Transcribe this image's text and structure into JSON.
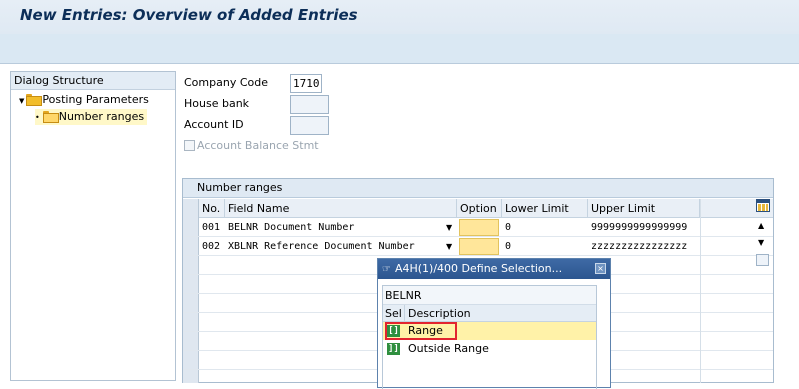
{
  "page": {
    "title": "New Entries: Overview of Added Entries"
  },
  "dialog_structure": {
    "heading": "Dialog Structure",
    "items": [
      {
        "label": "Posting Parameters",
        "level": 0,
        "expanded": true
      },
      {
        "label": "Number ranges",
        "level": 1,
        "selected": true
      }
    ]
  },
  "form": {
    "company_code_label": "Company Code",
    "company_code_value": "1710",
    "house_bank_label": "House bank",
    "house_bank_value": "",
    "account_id_label": "Account ID",
    "account_id_value": "",
    "account_balance_label": "Account Balance Stmt"
  },
  "table": {
    "title": "Number ranges",
    "columns": [
      "No.",
      "Field Name",
      "Option",
      "Lower Limit",
      "Upper Limit"
    ],
    "rows": [
      {
        "no": "001",
        "field": "BELNR Document Number",
        "option": "",
        "lower": "0",
        "upper": "9999999999999999"
      },
      {
        "no": "002",
        "field": "XBLNR Reference Document Number",
        "option": "",
        "lower": "0",
        "upper": "zzzzzzzzzzzzzzzz"
      }
    ]
  },
  "popup": {
    "title": "A4H(1)/400 Define Selection...",
    "field": "BELNR",
    "col_sel": "Sel",
    "col_desc": "Description",
    "options": [
      {
        "icon": "[]",
        "label": "Range",
        "highlighted": true
      },
      {
        "icon": "]]",
        "label": "Outside Range",
        "highlighted": false
      }
    ]
  }
}
